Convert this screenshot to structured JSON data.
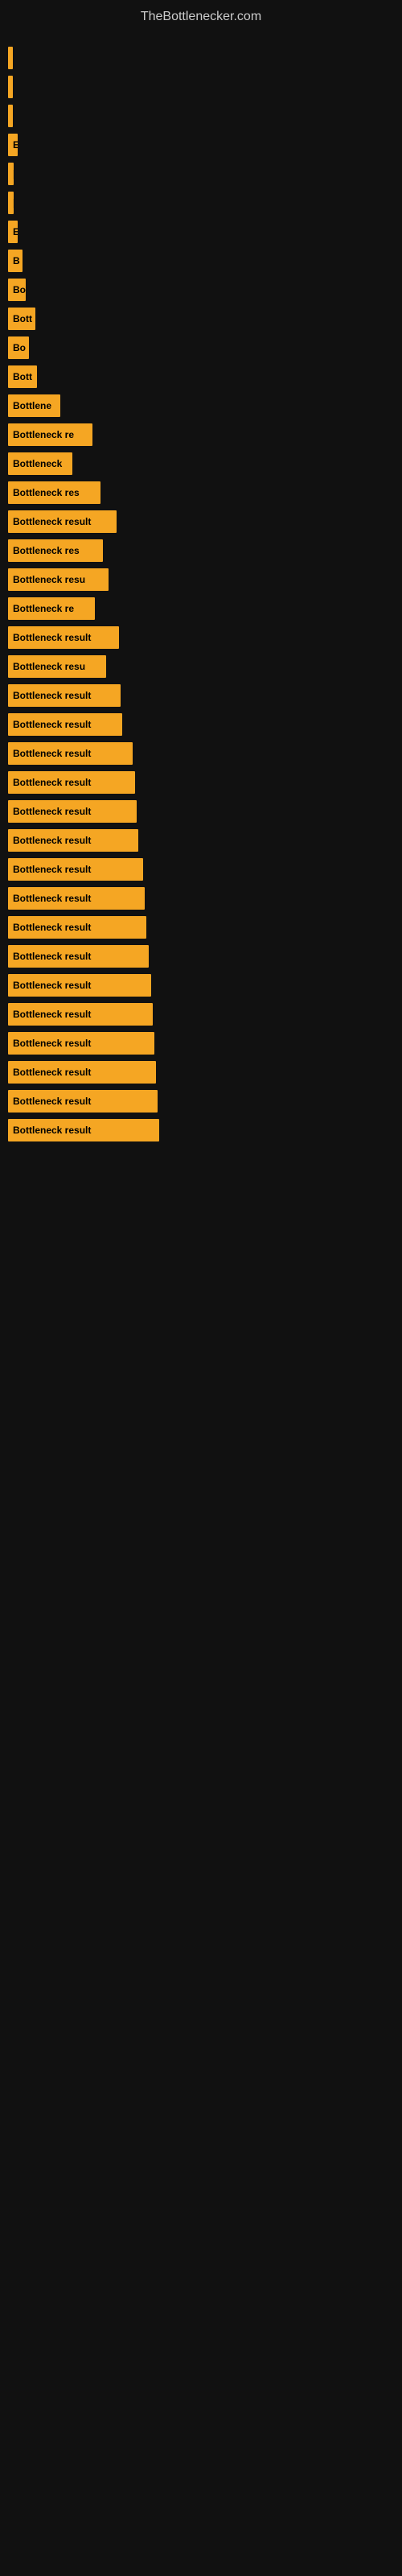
{
  "site": {
    "title": "TheBottlenecker.com"
  },
  "bars": [
    {
      "label": "|",
      "width": 4
    },
    {
      "label": "|",
      "width": 6
    },
    {
      "label": "|",
      "width": 6
    },
    {
      "label": "E",
      "width": 12
    },
    {
      "label": "|",
      "width": 7
    },
    {
      "label": "|",
      "width": 7
    },
    {
      "label": "E",
      "width": 12
    },
    {
      "label": "B",
      "width": 18
    },
    {
      "label": "Bo",
      "width": 22
    },
    {
      "label": "Bott",
      "width": 34
    },
    {
      "label": "Bo",
      "width": 26
    },
    {
      "label": "Bott",
      "width": 36
    },
    {
      "label": "Bottlene",
      "width": 65
    },
    {
      "label": "Bottleneck re",
      "width": 105
    },
    {
      "label": "Bottleneck",
      "width": 80
    },
    {
      "label": "Bottleneck res",
      "width": 115
    },
    {
      "label": "Bottleneck result",
      "width": 135
    },
    {
      "label": "Bottleneck res",
      "width": 118
    },
    {
      "label": "Bottleneck resu",
      "width": 125
    },
    {
      "label": "Bottleneck re",
      "width": 108
    },
    {
      "label": "Bottleneck result",
      "width": 138
    },
    {
      "label": "Bottleneck resu",
      "width": 122
    },
    {
      "label": "Bottleneck result",
      "width": 140
    },
    {
      "label": "Bottleneck result",
      "width": 142
    },
    {
      "label": "Bottleneck result",
      "width": 155
    },
    {
      "label": "Bottleneck result",
      "width": 158
    },
    {
      "label": "Bottleneck result",
      "width": 160
    },
    {
      "label": "Bottleneck result",
      "width": 162
    },
    {
      "label": "Bottleneck result",
      "width": 168
    },
    {
      "label": "Bottleneck result",
      "width": 170
    },
    {
      "label": "Bottleneck result",
      "width": 172
    },
    {
      "label": "Bottleneck result",
      "width": 175
    },
    {
      "label": "Bottleneck result",
      "width": 178
    },
    {
      "label": "Bottleneck result",
      "width": 180
    },
    {
      "label": "Bottleneck result",
      "width": 182
    },
    {
      "label": "Bottleneck result",
      "width": 184
    },
    {
      "label": "Bottleneck result",
      "width": 186
    },
    {
      "label": "Bottleneck result",
      "width": 188
    }
  ]
}
